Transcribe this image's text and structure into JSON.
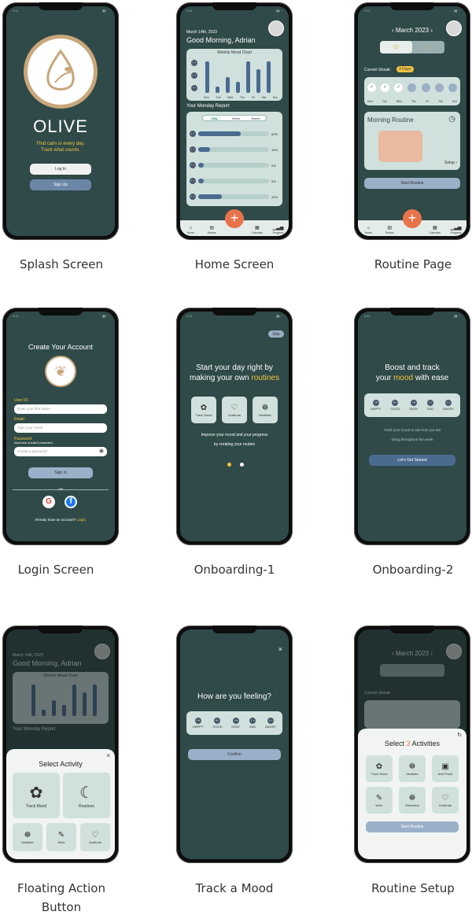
{
  "status_time": "9:41",
  "splash": {
    "app_name": "OLIVE",
    "tagline1": "Find calm in every day.",
    "tagline2": "Track what counts.",
    "login": "Log In",
    "signup": "Sign Up"
  },
  "home": {
    "date": "March 14th, 2023",
    "greeting": "Good Morning, Adrian",
    "chart_title": "Weekly Mood Chart",
    "report_title": "Your Monday Report",
    "seg": [
      "Day",
      "Week",
      "Month"
    ],
    "bars": [
      {
        "pct": "60%"
      },
      {
        "pct": "10%"
      },
      {
        "pct": "5%"
      },
      {
        "pct": "5%"
      },
      {
        "pct": "20%"
      }
    ],
    "days": [
      "Mon",
      "Tue",
      "Wed",
      "Thu",
      "Fri",
      "Sat",
      "Sun"
    ]
  },
  "nav": [
    "Home",
    "Entries",
    "Calendar",
    "Progress"
  ],
  "routine": {
    "month": "‹ March 2023 ›",
    "streak_label": "Current Streak:",
    "streak_value": "3 Days",
    "card_title": "Morning Routine",
    "setup": "Setup",
    "start": "Start Routine"
  },
  "login": {
    "title": "Create Your Account",
    "user_label": "User ID:",
    "user_ph": "Enter your first name",
    "email_label": "Email:",
    "email_ph": "Type your email",
    "pw_label": "Password:",
    "pw_hint": "Must have at least 8 characters",
    "pw_ph": "Create a password",
    "signin": "Sign In",
    "or": "OR",
    "footer_a": "Already have an account?",
    "footer_b": "Login."
  },
  "onb1": {
    "skip": "Skip",
    "line1": "Start your day right by",
    "line2a": "making your own ",
    "line2b": "routines",
    "tiles": [
      "Track Mood",
      "Gratitude",
      "Meditate"
    ],
    "body1": "Improve your mood and your progress",
    "body2": "by creating your routine"
  },
  "onb2": {
    "line1": "Boost and track",
    "line2a": "your ",
    "line2b": "mood",
    "line2c": " with ease",
    "moods": [
      "HAPPY",
      "GOOD",
      "OKAY",
      "SAD",
      "ANGRY"
    ],
    "body1": "Track your mood to see how you are",
    "body2": "doing throughout the week",
    "cta": "Let's Get Started"
  },
  "fab": {
    "sheet_title": "Select Activity",
    "big": [
      "Track Mood",
      "Routines"
    ],
    "small": [
      "Meditate",
      "Write",
      "Gratitude"
    ]
  },
  "track": {
    "question": "How are you feeling?",
    "confirm": "Confirm"
  },
  "setup": {
    "title_a": "Select ",
    "title_b": "3",
    "title_c": " Activities",
    "tiles": [
      "Track Mood",
      "Meditate",
      "Add Photo",
      "Write",
      "Reflection",
      "Gratitude"
    ],
    "start": "Start Routine"
  },
  "captions": [
    "Splash Screen",
    "Home Screen",
    "Routine Page",
    "Login Screen",
    "Onboarding-1",
    "Onboarding-2",
    "Floating Action",
    "Button",
    "Track a Mood",
    "Routine Setup"
  ],
  "colors": {
    "bg": "#2f4a48",
    "card": "#cfe0dd",
    "accent": "#f4c542",
    "bar": "#4a6a8f",
    "fab": "#e8734b"
  },
  "chart_data": {
    "type": "bar",
    "title": "Weekly Mood Chart",
    "categories": [
      "Mon",
      "Tue",
      "Wed",
      "Thu",
      "Fri",
      "Sat",
      "Sun"
    ]
  }
}
